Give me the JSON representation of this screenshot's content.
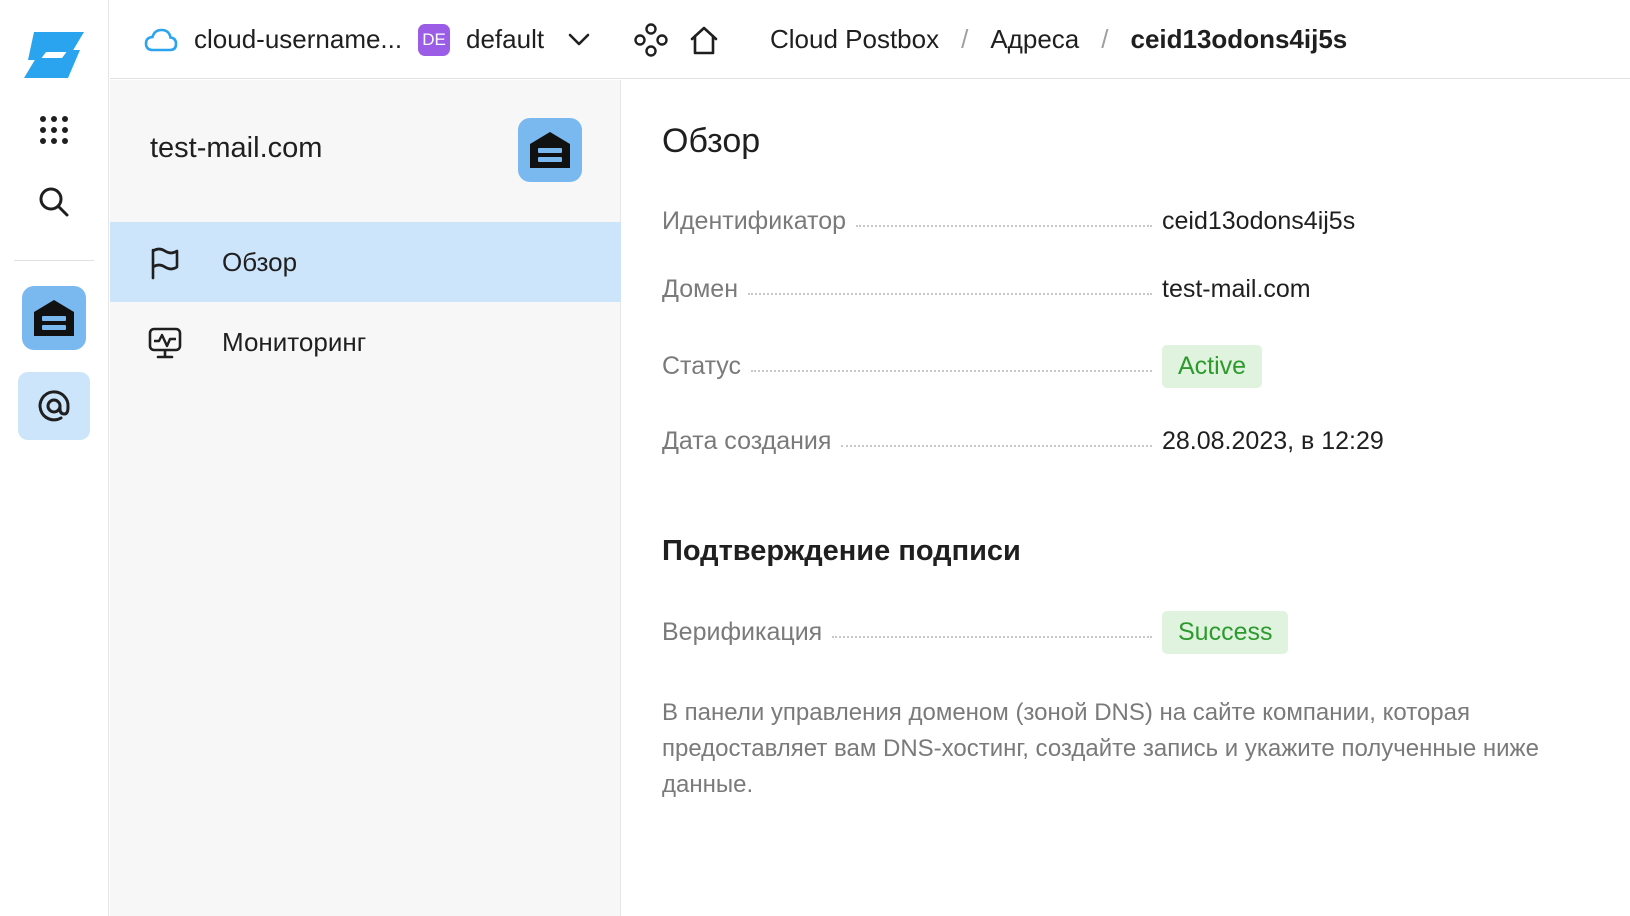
{
  "header": {
    "account": "cloud-username...",
    "folder_badge": "DE",
    "folder": "default",
    "breadcrumbs": [
      "Cloud Postbox",
      "Адреса",
      "ceid13odons4ij5s"
    ],
    "separator": "/"
  },
  "sidebar": {
    "title": "test-mail.com",
    "items": [
      {
        "label": "Обзор",
        "icon": "flag-icon",
        "active": true
      },
      {
        "label": "Мониторинг",
        "icon": "monitoring-icon",
        "active": false
      }
    ]
  },
  "main": {
    "title": "Обзор",
    "fields": [
      {
        "label": "Идентификатор",
        "value": "ceid13odons4ij5s"
      },
      {
        "label": "Домен",
        "value": "test-mail.com"
      },
      {
        "label": "Статус",
        "value": "Active"
      },
      {
        "label": "Дата создания",
        "value": "28.08.2023, в 12:29"
      }
    ],
    "signature_title": "Подтверждение подписи",
    "verification": {
      "label": "Верификация",
      "value": "Success"
    },
    "description": "В панели управления доменом (зоной DNS) на сайте компании, которая предоставляет вам DNS-хостинг, создайте запись и укажите полученные ниже данные."
  },
  "colors": {
    "accent_blue": "#7ab9f0",
    "active_bg": "#cde5fb",
    "success_bg": "#dff3df",
    "success_text": "#2e9a2e",
    "badge_purple": "#9b5de5"
  }
}
